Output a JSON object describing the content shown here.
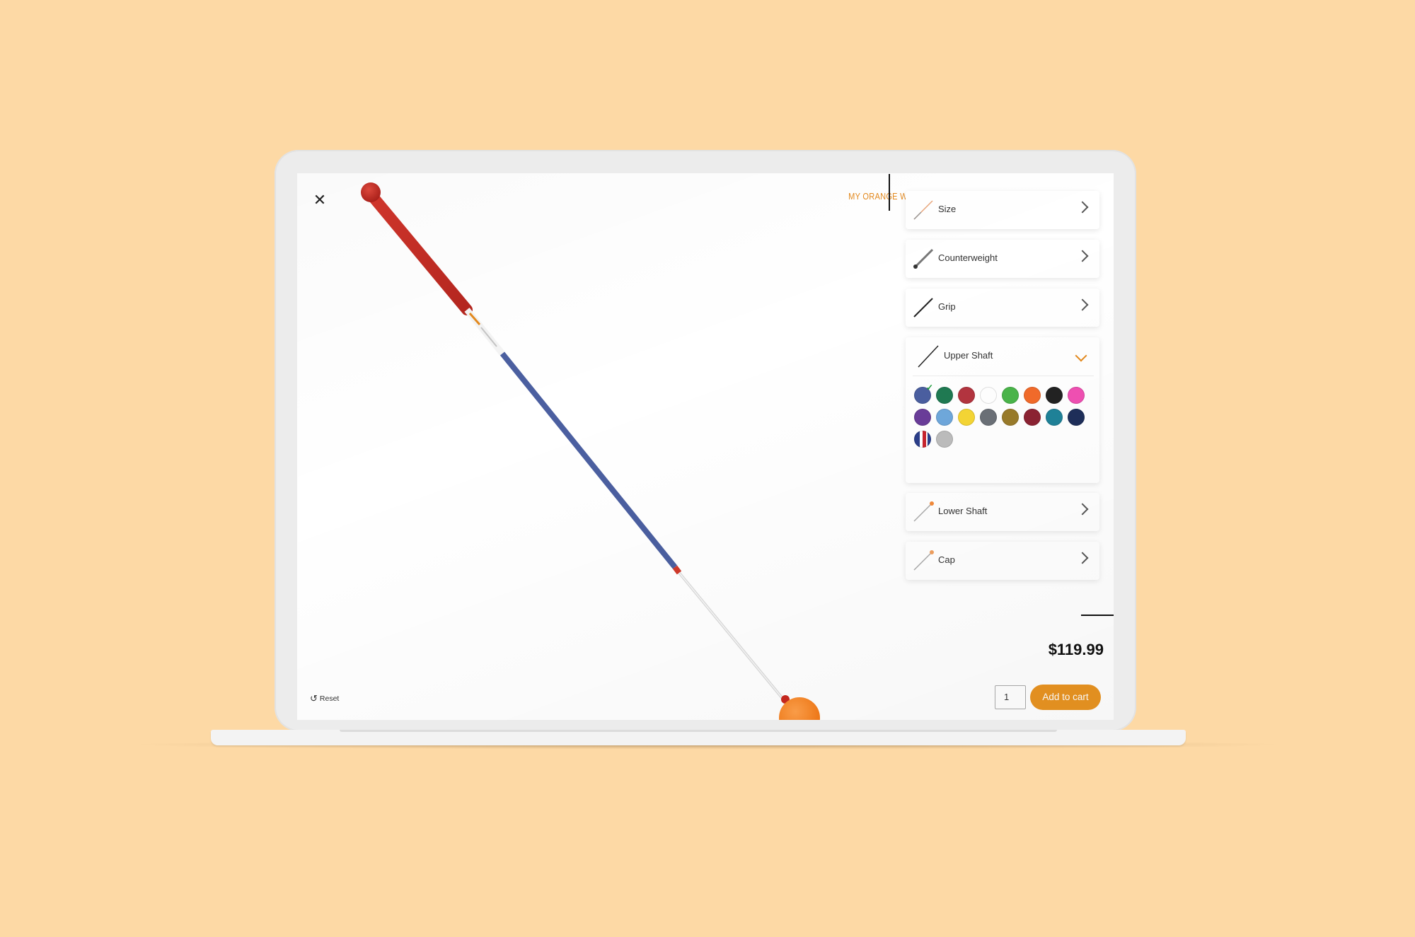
{
  "product": {
    "title": "MY ORANGE WHIP"
  },
  "options": [
    {
      "key": "size",
      "label": "Size",
      "icon": "whip-thumb-icon",
      "expanded": false
    },
    {
      "key": "counterweight",
      "label": "Counterweight",
      "icon": "counterweight-thumb-icon",
      "expanded": false
    },
    {
      "key": "grip",
      "label": "Grip",
      "icon": "grip-thumb-icon",
      "expanded": false
    },
    {
      "key": "upper_shaft",
      "label": "Upper Shaft",
      "icon": "upper-shaft-thumb-icon",
      "expanded": true
    },
    {
      "key": "lower_shaft",
      "label": "Lower Shaft",
      "icon": "lower-shaft-thumb-icon",
      "expanded": false
    },
    {
      "key": "cap",
      "label": "Cap",
      "icon": "cap-thumb-icon",
      "expanded": false
    }
  ],
  "upper_shaft_swatches": [
    {
      "color": "#4b5fa0",
      "selected": true
    },
    {
      "color": "#1f7a52"
    },
    {
      "color": "#b3343f"
    },
    {
      "color": "#ffffff"
    },
    {
      "color": "#4ab54a"
    },
    {
      "color": "#f26b2a"
    },
    {
      "color": "#222222"
    },
    {
      "color": "#f050b3"
    },
    {
      "color": "#6a3d99"
    },
    {
      "color": "#6fa8dc"
    },
    {
      "color": "#f5d634"
    },
    {
      "color": "#6b7077"
    },
    {
      "color": "#9a7b2a"
    },
    {
      "color": "#8c2233"
    },
    {
      "color": "#1f8299"
    },
    {
      "color": "#1e2f5a"
    },
    {
      "color": "flag-pattern"
    },
    {
      "color": "#bdbdbd"
    }
  ],
  "price": "$119.99",
  "quantity": "1",
  "add_to_cart_label": "Add to cart",
  "reset_label": "Reset",
  "colors": {
    "accent": "#e89321",
    "background": "#fdd9a5"
  }
}
